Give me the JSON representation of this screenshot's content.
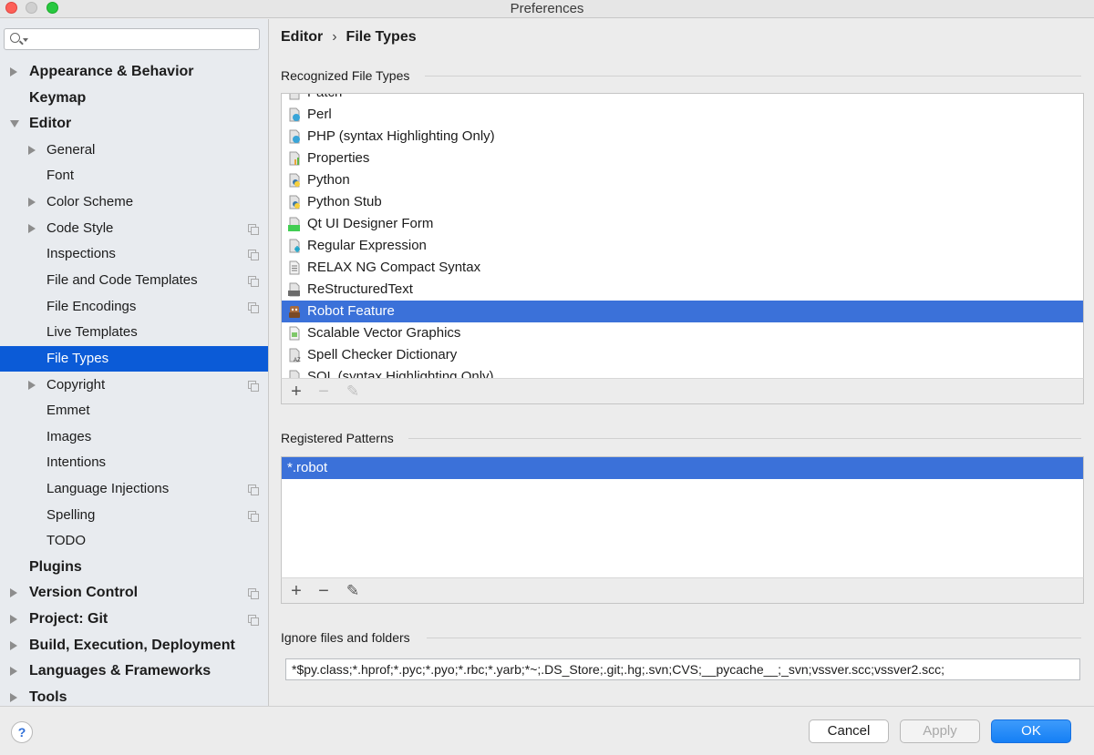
{
  "window": {
    "title": "Preferences"
  },
  "sidebar": {
    "search_placeholder": "",
    "items": [
      {
        "label": "Appearance & Behavior"
      },
      {
        "label": "Keymap"
      },
      {
        "label": "Editor"
      },
      {
        "label": "General"
      },
      {
        "label": "Font"
      },
      {
        "label": "Color Scheme"
      },
      {
        "label": "Code Style"
      },
      {
        "label": "Inspections"
      },
      {
        "label": "File and Code Templates"
      },
      {
        "label": "File Encodings"
      },
      {
        "label": "Live Templates"
      },
      {
        "label": "File Types"
      },
      {
        "label": "Copyright"
      },
      {
        "label": "Emmet"
      },
      {
        "label": "Images"
      },
      {
        "label": "Intentions"
      },
      {
        "label": "Language Injections"
      },
      {
        "label": "Spelling"
      },
      {
        "label": "TODO"
      },
      {
        "label": "Plugins"
      },
      {
        "label": "Version Control"
      },
      {
        "label": "Project: Git"
      },
      {
        "label": "Build, Execution, Deployment"
      },
      {
        "label": "Languages & Frameworks"
      },
      {
        "label": "Tools"
      }
    ]
  },
  "breadcrumb": {
    "parent": "Editor",
    "separator": "›",
    "current": "File Types"
  },
  "recognized": {
    "title": "Recognized File Types",
    "items": [
      {
        "label": "Patch",
        "icon": "patch-file-icon"
      },
      {
        "label": "Perl",
        "icon": "perl-file-icon"
      },
      {
        "label": "PHP (syntax Highlighting Only)",
        "icon": "php-file-icon"
      },
      {
        "label": "Properties",
        "icon": "properties-file-icon"
      },
      {
        "label": "Python",
        "icon": "python-file-icon"
      },
      {
        "label": "Python Stub",
        "icon": "python-stub-file-icon"
      },
      {
        "label": "Qt UI Designer Form",
        "icon": "qt-file-icon"
      },
      {
        "label": "Regular Expression",
        "icon": "regex-file-icon"
      },
      {
        "label": "RELAX NG Compact Syntax",
        "icon": "text-file-icon"
      },
      {
        "label": "ReStructuredText",
        "icon": "rst-file-icon"
      },
      {
        "label": "Robot Feature",
        "icon": "robot-file-icon"
      },
      {
        "label": "Scalable Vector Graphics",
        "icon": "svg-file-icon"
      },
      {
        "label": "Spell Checker Dictionary",
        "icon": "dictionary-file-icon"
      },
      {
        "label": "SQL (syntax Highlighting Only)",
        "icon": "sql-file-icon"
      }
    ]
  },
  "patterns": {
    "title": "Registered Patterns",
    "items": [
      {
        "label": "*.robot"
      }
    ]
  },
  "ignore": {
    "title": "Ignore files and folders",
    "value": "*$py.class;*.hprof;*.pyc;*.pyo;*.rbc;*.yarb;*~;.DS_Store;.git;.hg;.svn;CVS;__pycache__;_svn;vssver.scc;vssver2.scc;"
  },
  "toolbar_glyphs": {
    "add": "+",
    "remove": "−",
    "edit": "✎"
  },
  "footer": {
    "help": "?",
    "cancel": "Cancel",
    "apply": "Apply",
    "ok": "OK"
  },
  "colors": {
    "selection": "#3b71d9",
    "sidebar_selection": "#0b5bd7",
    "ok_button": "#1f8cf7"
  }
}
